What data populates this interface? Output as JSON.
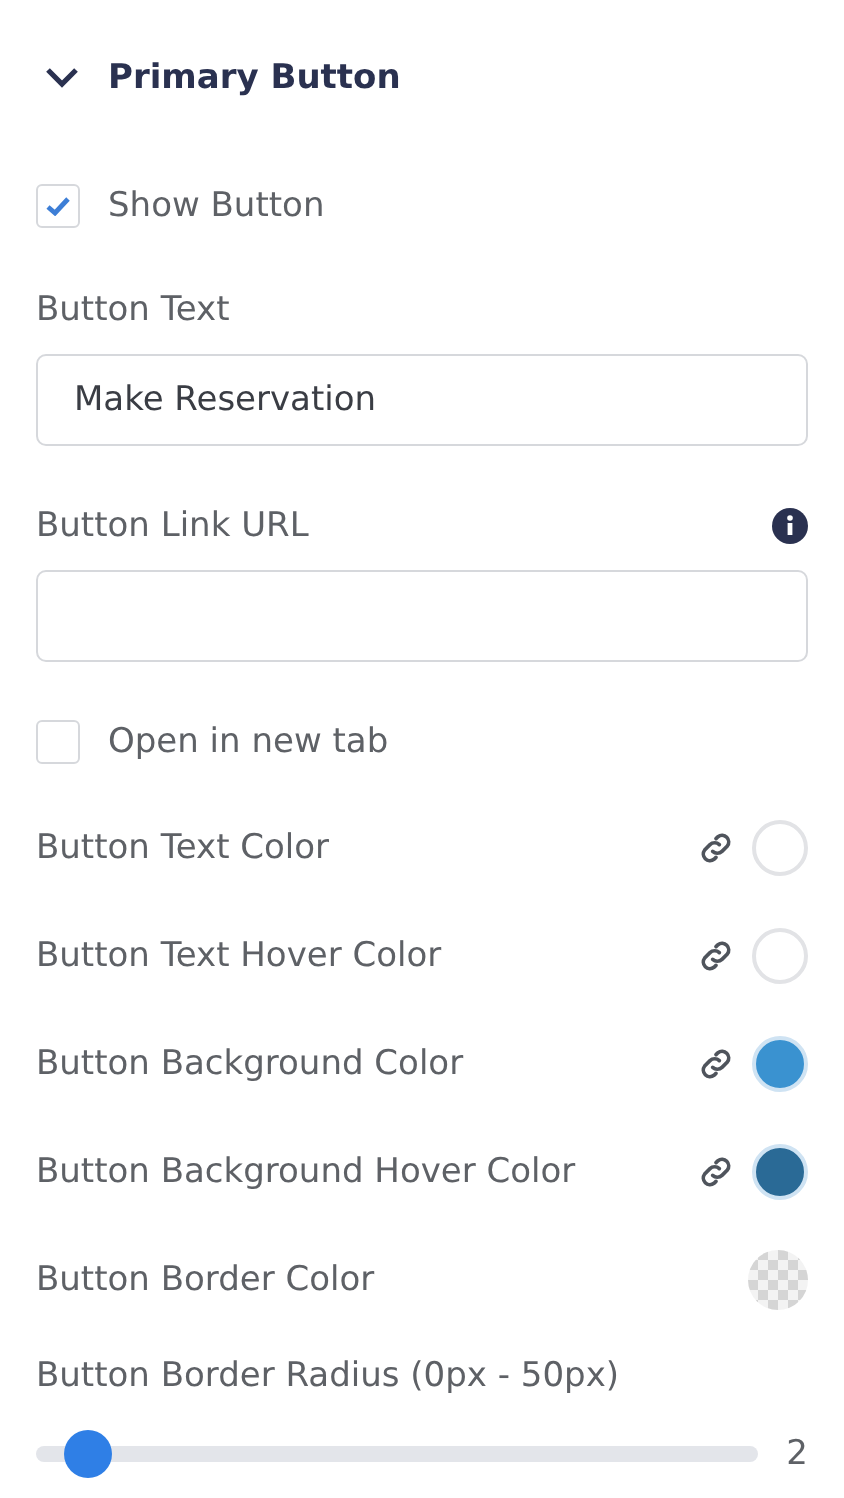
{
  "section": {
    "title": "Primary Button",
    "expanded": true
  },
  "show_button": {
    "label": "Show Button",
    "checked": true
  },
  "button_text": {
    "label": "Button Text",
    "value": "Make Reservation"
  },
  "button_link": {
    "label": "Button Link URL",
    "info": true
  },
  "new_tab": {
    "label": "Open in new tab",
    "checked": false
  },
  "color_rows": [
    {
      "label": "Button Text Color",
      "linked": true,
      "kind": "solid",
      "color": "#ffffff"
    },
    {
      "label": "Button Text Hover Color",
      "linked": true,
      "kind": "solid",
      "color": "#ffffff"
    },
    {
      "label": "Button Background Color",
      "linked": true,
      "kind": "solid",
      "color": "#3a92d0"
    },
    {
      "label": "Button Background Hover Color",
      "linked": true,
      "kind": "solid",
      "color": "#2a6a96"
    },
    {
      "label": "Button Border Color",
      "linked": false,
      "kind": "transparent"
    }
  ],
  "radius": {
    "label": "Button Border Radius (0px - 50px)",
    "level": 0.04,
    "reading": "2"
  }
}
